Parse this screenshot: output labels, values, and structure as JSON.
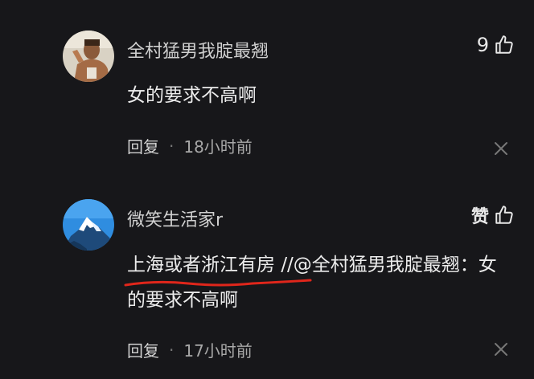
{
  "comments": [
    {
      "username": "全村猛男我腚最翘",
      "likes": "9",
      "text": "女的要求不高啊",
      "reply_label": "回复",
      "separator": "·",
      "time": "18小时前"
    },
    {
      "username": "微笑生活家r",
      "like_word": "赞",
      "text_highlight": "上海或者浙江有房",
      "text_rest": "//@全村猛男我腚最翘：女的要求不高啊",
      "reply_label": "回复",
      "separator": "·",
      "time": "17小时前"
    }
  ],
  "colors": {
    "background": "#17171a",
    "underline": "#e0261b",
    "mountain_sky": "#2f8de0"
  },
  "icons": [
    "thumbs-up-icon",
    "close-icon"
  ]
}
